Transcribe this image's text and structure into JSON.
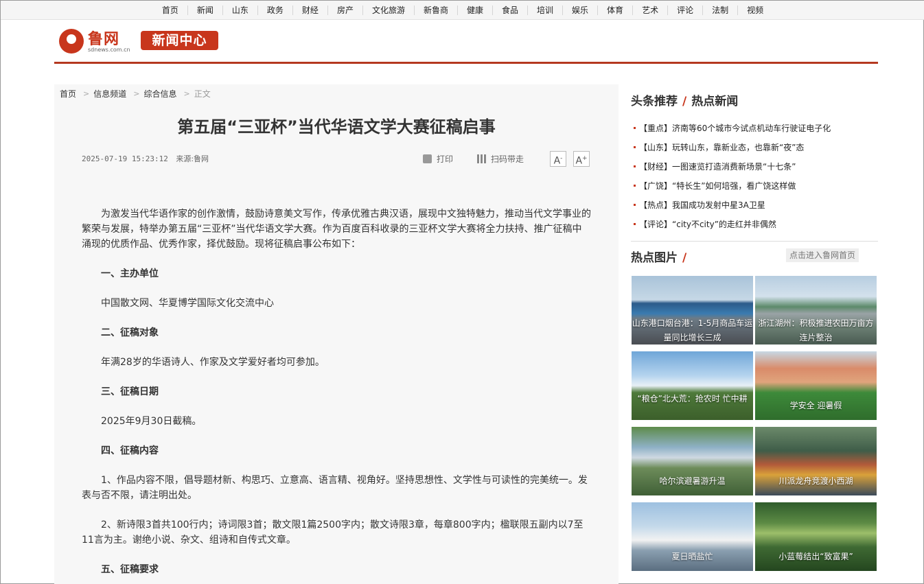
{
  "nav": [
    "首页",
    "新闻",
    "山东",
    "政务",
    "财经",
    "房产",
    "文化旅游",
    "新鲁商",
    "健康",
    "食品",
    "培训",
    "娱乐",
    "体育",
    "艺术",
    "评论",
    "法制",
    "视频"
  ],
  "logo": {
    "name": "鲁网",
    "domain": "sdnews.com.cn",
    "channel": "新闻中心"
  },
  "breadcrumb": {
    "home": "首页",
    "channel": "信息频道",
    "section": "综合信息",
    "current": "正文"
  },
  "article": {
    "title": "第五届“三亚杯”当代华语文学大赛征稿启事",
    "datetime": "2025-07-19 15:23:12",
    "source": "来源:鲁网",
    "print_label": "打印",
    "qr_label": "扫码带走",
    "font_smaller": "A",
    "font_larger": "A",
    "paragraphs": [
      {
        "text": "为激发当代华语作家的创作激情，鼓励诗意美文写作，传承优雅古典汉语，展现中文独特魅力，推动当代文学事业的繁荣与发展，特举办第五届“三亚杯”当代华语文学大赛。作为百度百科收录的三亚杯文学大赛将全力扶持、推广征稿中涌现的优质作品、优秀作家，择优鼓励。现将征稿启事公布如下：",
        "bold": false
      },
      {
        "text": "一、主办单位",
        "bold": true
      },
      {
        "text": "中国散文网、华夏博学国际文化交流中心",
        "bold": false
      },
      {
        "text": "二、征稿对象",
        "bold": true
      },
      {
        "text": "年满28岁的华语诗人、作家及文学爱好者均可参加。",
        "bold": false
      },
      {
        "text": "三、征稿日期",
        "bold": true
      },
      {
        "text": "2025年9月30日截稿。",
        "bold": false
      },
      {
        "text": "四、征稿内容",
        "bold": true
      },
      {
        "text": "1、作品内容不限，倡导题材新、构思巧、立意高、语言精、视角好。坚持思想性、文学性与可读性的完美统一。发表与否不限，请注明出处。",
        "bold": false
      },
      {
        "text": "2、新诗限3首共100行内；诗词限3首；散文限1篇2500字内；散文诗限3章，每章800字内；楹联限五副内以7至11言为主。谢绝小说、杂文、组诗和自传式文章。",
        "bold": false
      },
      {
        "text": "五、征稿要求",
        "bold": true
      }
    ]
  },
  "sidebar": {
    "headline_title": "头条推荐",
    "hot_title": "热点新闻",
    "news": [
      "【重点】济南等60个城市今试点机动车行驶证电子化",
      "【山东】玩转山东，靠新业态，也靠新“夜”态",
      "【财经】一图速览打造消费新场景“十七条”",
      "【广饶】“特长生”如何培强，看广饶这样做",
      "【热点】我国成功发射中星3A卫星",
      "【评论】“city不city”的走红并非偶然"
    ],
    "pics_title": "热点图片",
    "home_button": "点击进入鲁网首页",
    "pics": [
      {
        "caption": "山东港口烟台港：1-5月商品车运量同比增长三成"
      },
      {
        "caption": "浙江湖州：积极推进农田万亩方连片整治"
      },
      {
        "caption": "“粮仓”北大荒：抢农时 忙中耕"
      },
      {
        "caption": "学安全 迎暑假"
      },
      {
        "caption": "哈尔滨避暑游升温"
      },
      {
        "caption": "川派龙舟竞渡小西湖"
      },
      {
        "caption": "夏日晒盐忙"
      },
      {
        "caption": "小蓝莓结出“致富果”"
      }
    ]
  }
}
